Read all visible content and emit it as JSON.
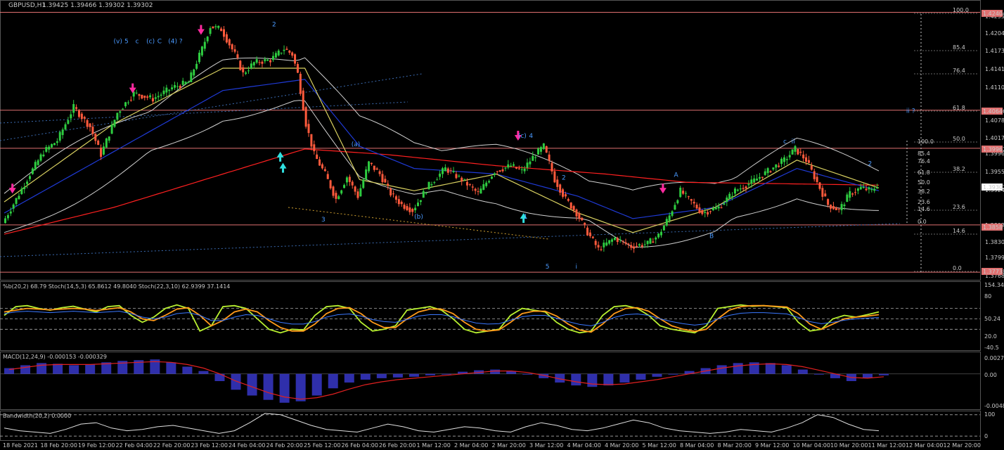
{
  "header": {
    "symbol": "GBPUSD,H1",
    "ohlc": "1.39425 1.39466 1.39302 1.39302"
  },
  "indicators": {
    "stoch": "%b(20,2) 68.79  Stoch(14,5,3) 65.8612 49.8040  Stoch(22,3,10) 62.9399 37.1414",
    "macd": "MACD(12,24,9) -0.000153 -0.000329",
    "bandwidth": "Bandwidth(20,2) 0.0000"
  },
  "colors": {
    "background": "#000000",
    "bull_candle": "#2ecc40",
    "bear_candle": "#ff5a3c",
    "ma_slow": "#ff2020",
    "ma_mid": "#1f3ad6",
    "ma_fast": "#d8d060",
    "bands": "#d0d0d0",
    "level_line": "#e07070",
    "stoch_main": "#b8f030",
    "stoch_signal": "#ff9a1a",
    "pctb": "#3a78ff",
    "macd_hist": "#3b3bd6",
    "macd_signal": "#e02020",
    "wave_label": "#4a9aff",
    "arrow_down": "#ff2aa0",
    "arrow_up": "#30e0e0"
  },
  "chart_data": [
    {
      "type": "candlestick",
      "y_axis_ticks": [
        "1.42550",
        "1.42040",
        "1.41730",
        "1.41415",
        "1.41105",
        "1.40780",
        "1.40170",
        "1.39960",
        "1.39550",
        "1.39240",
        "1.38925",
        "1.38305",
        "1.37995",
        "1.37680"
      ],
      "price_tags": [
        "1.42404",
        "1.40646",
        "1.39962",
        "1.39302",
        "1.38587",
        "1.37738"
      ],
      "x_axis_ticks": [
        "18 Feb 2021",
        "18 Feb 20:00",
        "19 Feb 12:00",
        "22 Feb 04:00",
        "22 Feb 20:00",
        "23 Feb 12:00",
        "24 Feb 04:00",
        "24 Feb 20:00",
        "25 Feb 12:00",
        "26 Feb 04:00",
        "26 Feb 20:00",
        "1 Mar 12:00",
        "2 Mar 04:00",
        "2 Mar 20:00",
        "3 Mar 12:00",
        "4 Mar 04:00",
        "4 Mar 20:00",
        "5 Mar 12:00",
        "8 Mar 04:00",
        "8 Mar 20:00",
        "9 Mar 12:00",
        "10 Mar 04:00",
        "10 Mar 20:00",
        "11 Mar 12:00",
        "12 Mar 04:00",
        "12 Mar 20:00"
      ],
      "price_path": [
        [
          0,
          1.3862
        ],
        [
          5,
          1.3905
        ],
        [
          10,
          1.395
        ],
        [
          15,
          1.399
        ],
        [
          20,
          1.401
        ],
        [
          26,
          1.407
        ],
        [
          32,
          1.4035
        ],
        [
          36,
          1.3985
        ],
        [
          42,
          1.406
        ],
        [
          48,
          1.4095
        ],
        [
          55,
          1.4085
        ],
        [
          62,
          1.4105
        ],
        [
          68,
          1.4115
        ],
        [
          73,
          1.4175
        ],
        [
          76,
          1.4215
        ],
        [
          80,
          1.421
        ],
        [
          85,
          1.4165
        ],
        [
          88,
          1.413
        ],
        [
          92,
          1.415
        ],
        [
          98,
          1.4155
        ],
        [
          103,
          1.4175
        ],
        [
          106,
          1.4165
        ],
        [
          108,
          1.413
        ],
        [
          111,
          1.404
        ],
        [
          114,
          1.3985
        ],
        [
          118,
          1.395
        ],
        [
          122,
          1.3905
        ],
        [
          126,
          1.3945
        ],
        [
          130,
          1.391
        ],
        [
          134,
          1.397
        ],
        [
          138,
          1.395
        ],
        [
          142,
          1.3915
        ],
        [
          146,
          1.3895
        ],
        [
          150,
          1.3885
        ],
        [
          156,
          1.393
        ],
        [
          162,
          1.396
        ],
        [
          168,
          1.394
        ],
        [
          174,
          1.3915
        ],
        [
          180,
          1.3955
        ],
        [
          186,
          1.3965
        ],
        [
          190,
          1.3955
        ],
        [
          194,
          1.398
        ],
        [
          198,
          1.4
        ],
        [
          202,
          1.394
        ],
        [
          206,
          1.3905
        ],
        [
          210,
          1.388
        ],
        [
          214,
          1.3845
        ],
        [
          218,
          1.3815
        ],
        [
          224,
          1.3835
        ],
        [
          230,
          1.382
        ],
        [
          236,
          1.3825
        ],
        [
          240,
          1.384
        ],
        [
          244,
          1.3875
        ],
        [
          248,
          1.392
        ],
        [
          252,
          1.39
        ],
        [
          256,
          1.388
        ],
        [
          262,
          1.389
        ],
        [
          268,
          1.392
        ],
        [
          274,
          1.3935
        ],
        [
          280,
          1.3955
        ],
        [
          286,
          1.3975
        ],
        [
          290,
          1.3995
        ],
        [
          294,
          1.3975
        ],
        [
          298,
          1.3935
        ],
        [
          302,
          1.3895
        ],
        [
          306,
          1.3885
        ],
        [
          310,
          1.3915
        ],
        [
          314,
          1.3925
        ],
        [
          318,
          1.392
        ],
        [
          320,
          1.393
        ]
      ],
      "moving_averages": {
        "slow": [
          [
            0,
            1.3842
          ],
          [
            40,
            1.389
          ],
          [
            80,
            1.395
          ],
          [
            110,
            1.3995
          ],
          [
            140,
            1.3985
          ],
          [
            180,
            1.3965
          ],
          [
            220,
            1.395
          ],
          [
            250,
            1.3935
          ],
          [
            280,
            1.3933
          ],
          [
            320,
            1.393
          ]
        ],
        "mid": [
          [
            0,
            1.388
          ],
          [
            40,
            1.399
          ],
          [
            80,
            1.41
          ],
          [
            110,
            1.412
          ],
          [
            130,
            1.4
          ],
          [
            150,
            1.396
          ],
          [
            180,
            1.395
          ],
          [
            210,
            1.391
          ],
          [
            230,
            1.387
          ],
          [
            260,
            1.389
          ],
          [
            290,
            1.396
          ],
          [
            320,
            1.392
          ]
        ],
        "fast": [
          [
            0,
            1.39
          ],
          [
            40,
            1.404
          ],
          [
            80,
            1.414
          ],
          [
            110,
            1.414
          ],
          [
            130,
            1.394
          ],
          [
            150,
            1.392
          ],
          [
            180,
            1.395
          ],
          [
            210,
            1.388
          ],
          [
            230,
            1.3845
          ],
          [
            260,
            1.389
          ],
          [
            290,
            1.3975
          ],
          [
            320,
            1.3925
          ]
        ]
      },
      "levels": [
        1.42404,
        1.40646,
        1.39962,
        1.38587,
        1.37738
      ],
      "wave_labels": [
        {
          "text": "(v)",
          "i": 40,
          "p": 1.4185
        },
        {
          "text": "5",
          "i": 44,
          "p": 1.4185
        },
        {
          "text": "c",
          "i": 48,
          "p": 1.4185
        },
        {
          "text": "(c)",
          "i": 52,
          "p": 1.4185
        },
        {
          "text": "C",
          "i": 56,
          "p": 1.4185
        },
        {
          "text": "(4) ?",
          "i": 60,
          "p": 1.4185
        },
        {
          "text": "2",
          "i": 98,
          "p": 1.4215
        },
        {
          "text": "(a)",
          "i": 127,
          "p": 1.4
        },
        {
          "text": "3",
          "i": 116,
          "p": 1.3865
        },
        {
          "text": "(b)",
          "i": 150,
          "p": 1.387
        },
        {
          "text": "(c)",
          "i": 188,
          "p": 1.4015
        },
        {
          "text": "4",
          "i": 192,
          "p": 1.4015
        },
        {
          "text": "1",
          "i": 190,
          "p": 1.387
        },
        {
          "text": "2",
          "i": 204,
          "p": 1.394
        },
        {
          "text": "5",
          "i": 198,
          "p": 1.378
        },
        {
          "text": "i",
          "i": 209,
          "p": 1.378
        },
        {
          "text": "A",
          "i": 245,
          "p": 1.3945
        },
        {
          "text": "B",
          "i": 258,
          "p": 1.3835
        },
        {
          "text": "c",
          "i": 285,
          "p": 1.4005
        },
        {
          "text": "ii",
          "i": 288,
          "p": 1.4005
        },
        {
          "text": "ii ?",
          "i": 330,
          "p": 1.406
        },
        {
          "text": "2",
          "i": 316,
          "p": 1.3965
        }
      ],
      "fib_labels": [
        "100.0",
        "85.4",
        "76.4",
        "61.8",
        "50.0",
        "38.2",
        "23.6",
        "14.6",
        "0.0"
      ],
      "fib_labels_short": [
        "100.0",
        "85.4",
        "76.4",
        "61.8",
        "50.0",
        "38.2",
        "23.6",
        "14.6",
        "0.0"
      ]
    },
    {
      "type": "line",
      "name_label": "Stoch",
      "y_axis_ticks": [
        "154.34",
        "80",
        "50.24",
        "20.0",
        "-40.5"
      ],
      "series": [
        {
          "key": "main",
          "values": [
            60,
            85,
            88,
            80,
            75,
            82,
            86,
            78,
            70,
            85,
            88,
            60,
            40,
            55,
            80,
            90,
            80,
            15,
            30,
            85,
            88,
            80,
            50,
            20,
            10,
            20,
            18,
            60,
            85,
            88,
            80,
            40,
            15,
            20,
            30,
            75,
            80,
            85,
            75,
            50,
            20,
            10,
            15,
            20,
            60,
            80,
            75,
            70,
            40,
            20,
            10,
            15,
            60,
            85,
            88,
            80,
            60,
            30,
            20,
            15,
            10,
            30,
            80,
            85,
            90,
            86,
            88,
            85,
            82,
            40,
            15,
            20,
            50,
            60,
            55,
            62,
            70
          ]
        },
        {
          "key": "signal",
          "values": [
            70,
            75,
            80,
            78,
            76,
            78,
            80,
            78,
            74,
            78,
            82,
            70,
            50,
            45,
            60,
            78,
            82,
            60,
            30,
            45,
            70,
            78,
            70,
            45,
            25,
            15,
            15,
            35,
            65,
            80,
            82,
            65,
            40,
            25,
            25,
            50,
            70,
            78,
            78,
            65,
            40,
            20,
            15,
            18,
            40,
            65,
            72,
            72,
            58,
            35,
            18,
            12,
            35,
            65,
            80,
            82,
            72,
            50,
            30,
            20,
            14,
            20,
            50,
            75,
            85,
            88,
            88,
            86,
            84,
            65,
            35,
            20,
            35,
            50,
            55,
            58,
            62
          ]
        },
        {
          "key": "pctb",
          "values": [
            65,
            70,
            72,
            70,
            68,
            70,
            72,
            70,
            68,
            70,
            72,
            65,
            55,
            50,
            55,
            65,
            68,
            60,
            45,
            45,
            55,
            62,
            60,
            50,
            40,
            35,
            35,
            42,
            55,
            62,
            64,
            58,
            48,
            42,
            40,
            48,
            58,
            62,
            62,
            56,
            46,
            38,
            35,
            36,
            46,
            56,
            60,
            60,
            52,
            42,
            34,
            30,
            40,
            54,
            62,
            64,
            60,
            50,
            42,
            36,
            32,
            36,
            50,
            60,
            66,
            68,
            68,
            66,
            64,
            54,
            42,
            36,
            40,
            46,
            50,
            52,
            54
          ]
        }
      ],
      "range": [
        -40,
        154
      ]
    },
    {
      "type": "bar",
      "name_label": "MACD",
      "y_axis_ticks": [
        "0.002797",
        "0.00",
        "-0.004835"
      ],
      "histogram": [
        0.0008,
        0.0012,
        0.0015,
        0.0014,
        0.0012,
        0.0013,
        0.0016,
        0.0018,
        0.0019,
        0.002,
        0.0016,
        0.001,
        0.0004,
        -0.001,
        -0.0022,
        -0.003,
        -0.0036,
        -0.004,
        -0.0038,
        -0.003,
        -0.002,
        -0.0012,
        -0.0008,
        -0.0006,
        -0.0005,
        -0.0004,
        -0.0002,
        0.0,
        0.0003,
        0.0005,
        0.0006,
        0.0004,
        0.0,
        -0.0006,
        -0.0012,
        -0.0016,
        -0.0018,
        -0.0016,
        -0.0012,
        -0.0008,
        -0.0004,
        0.0,
        0.0004,
        0.0008,
        0.0012,
        0.0015,
        0.0016,
        0.0015,
        0.0012,
        0.0006,
        0.0,
        -0.0006,
        -0.001,
        -0.0006,
        -0.0002
      ],
      "signal": [
        0.0006,
        0.0009,
        0.0012,
        0.0013,
        0.0013,
        0.0013,
        0.0014,
        0.0015,
        0.0016,
        0.0017,
        0.0016,
        0.0013,
        0.0008,
        0.0,
        -0.001,
        -0.0018,
        -0.0026,
        -0.0032,
        -0.0035,
        -0.0033,
        -0.0028,
        -0.0021,
        -0.0015,
        -0.0011,
        -0.0008,
        -0.0006,
        -0.0004,
        -0.0002,
        0.0,
        0.0002,
        0.0004,
        0.0004,
        0.0002,
        -0.0002,
        -0.0007,
        -0.0011,
        -0.0014,
        -0.0015,
        -0.0014,
        -0.0011,
        -0.0008,
        -0.0004,
        0.0,
        0.0004,
        0.0008,
        0.0011,
        0.0013,
        0.0014,
        0.0013,
        0.001,
        0.0005,
        0.0,
        -0.0005,
        -0.0006,
        -0.0004
      ],
      "range": [
        -0.0048,
        0.0028
      ]
    },
    {
      "type": "line",
      "name_label": "Bandwidth",
      "y_axis_ticks": [
        "100",
        "0"
      ],
      "values": [
        40,
        30,
        25,
        20,
        35,
        55,
        60,
        40,
        30,
        35,
        45,
        50,
        40,
        30,
        20,
        30,
        60,
        95,
        90,
        70,
        50,
        35,
        30,
        25,
        40,
        55,
        45,
        30,
        25,
        35,
        45,
        40,
        30,
        25,
        45,
        60,
        50,
        35,
        30,
        40,
        55,
        70,
        60,
        40,
        30,
        25,
        20,
        25,
        35,
        30,
        25,
        40,
        60,
        90,
        80,
        55,
        35,
        30
      ],
      "range": [
        0,
        100
      ]
    }
  ]
}
